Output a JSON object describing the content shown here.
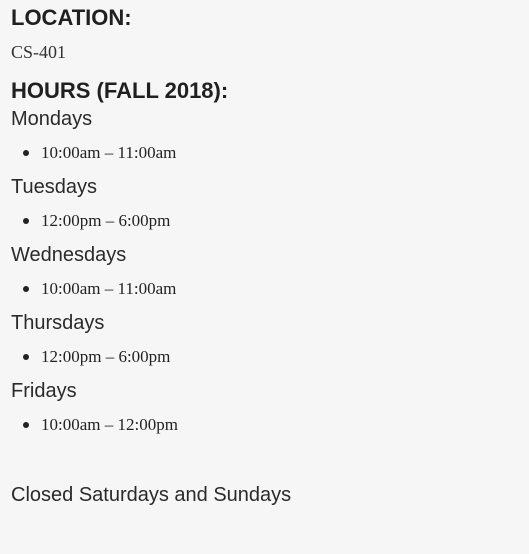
{
  "location": {
    "heading": "LOCATION:",
    "value": "CS-401"
  },
  "hours": {
    "heading": "HOURS (FALL 2018):",
    "days": [
      {
        "name": "Mondays",
        "time": "10:00am – 11:00am"
      },
      {
        "name": "Tuesdays",
        "time": "12:00pm – 6:00pm"
      },
      {
        "name": "Wednesdays",
        "time": "10:00am – 11:00am"
      },
      {
        "name": "Thursdays",
        "time": "12:00pm – 6:00pm"
      },
      {
        "name": "Fridays",
        "time": "10:00am – 12:00pm"
      }
    ]
  },
  "closed_note": "Closed Saturdays and Sundays"
}
